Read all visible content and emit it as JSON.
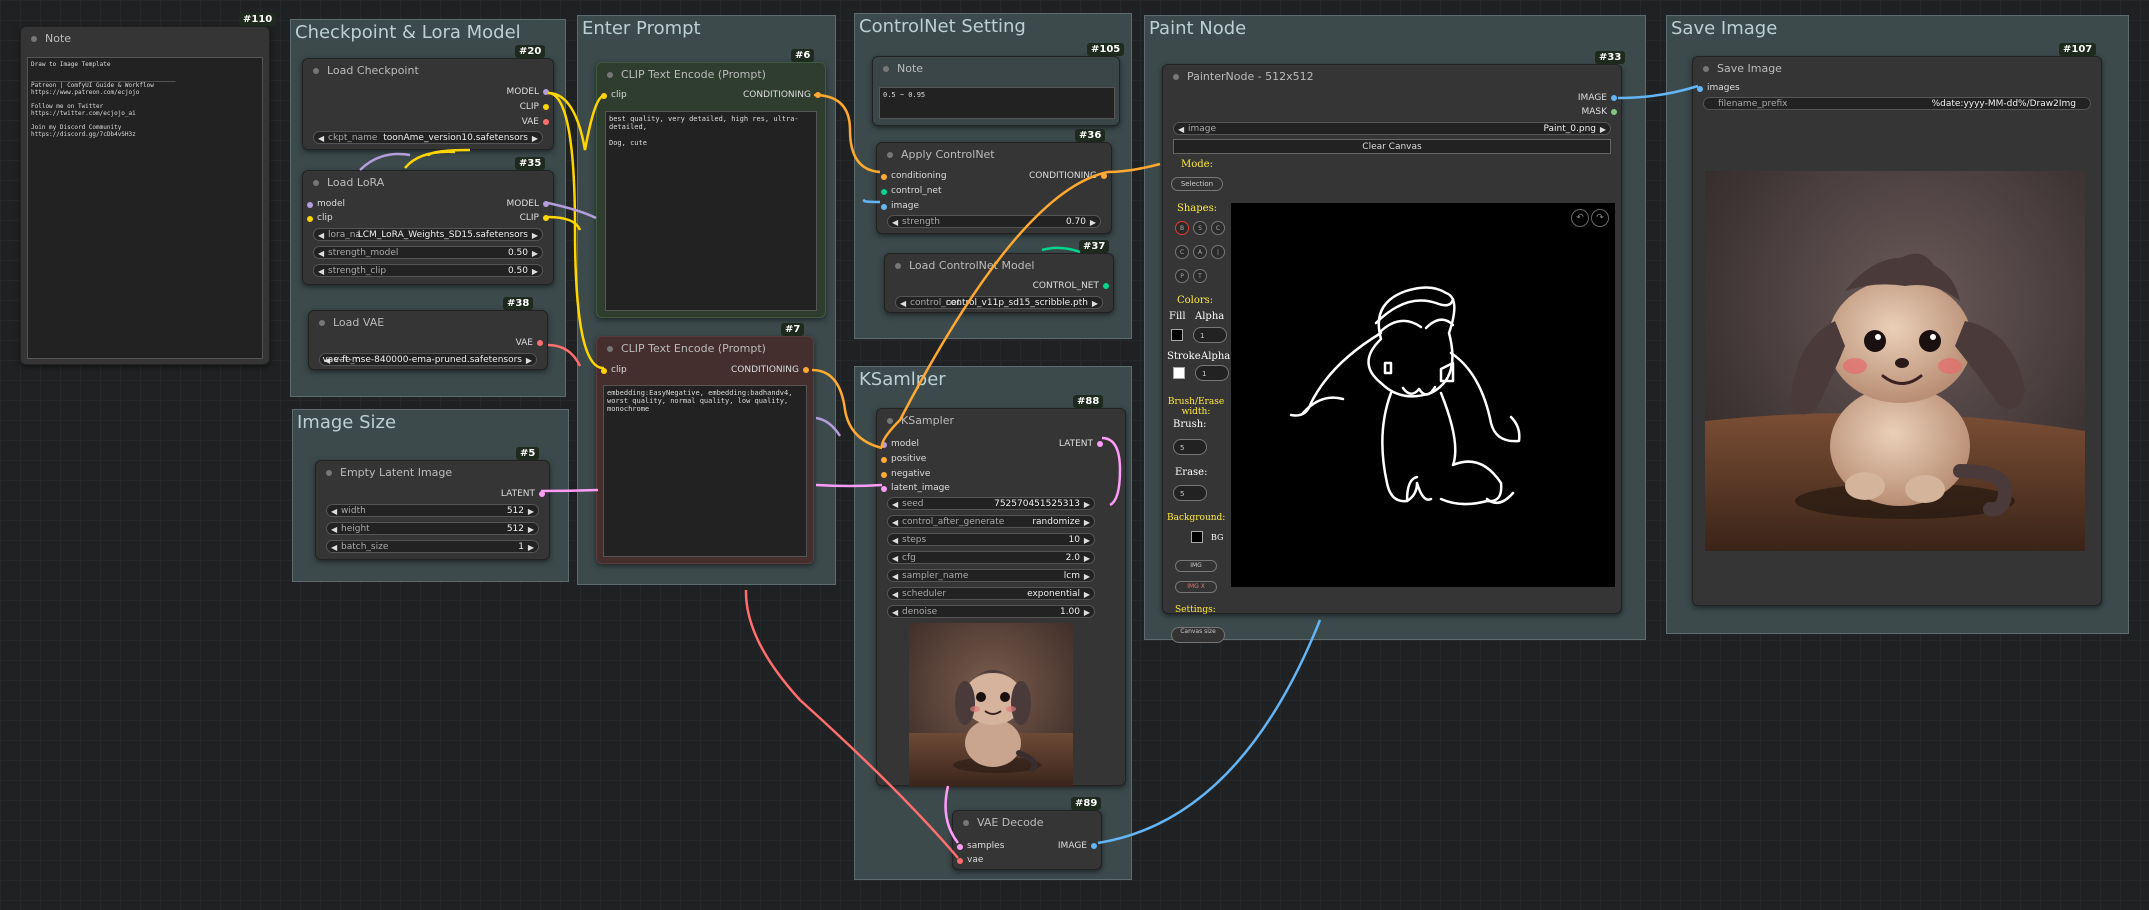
{
  "groups": {
    "checkpoint": "Checkpoint & Lora Model",
    "image_size": "Image Size",
    "prompt": "Enter Prompt",
    "controlnet": "ControlNet Setting",
    "ksampler": "KSamlper",
    "paint": "Paint Node",
    "save": "Save Image"
  },
  "note110": {
    "title": "Note",
    "badge": "#110",
    "text": "Draw to Image Template\n\n________________________________________\nPatreon | ComfyUI Guide & Workflow\nhttps://www.patreon.com/ecjojo\n\nFollow me on Twitter\nhttps://twitter.com/ecjojo_ai\n\nJoin my Discord Community\nhttps://discord.gg/7cDb4vSH3z"
  },
  "load_checkpoint": {
    "title": "Load Checkpoint",
    "badge": "#20",
    "out_model": "MODEL",
    "out_clip": "CLIP",
    "out_vae": "VAE",
    "ckpt_label": "ckpt_name",
    "ckpt_value": "toonAme_version10.safetensors"
  },
  "load_lora": {
    "title": "Load LoRA",
    "badge": "#35",
    "in_model": "model",
    "in_clip": "clip",
    "out_model": "MODEL",
    "out_clip": "CLIP",
    "lora_label": "lora_na",
    "lora_value": "LCM_LoRA_Weights_SD15.safetensors",
    "strength_model_label": "strength_model",
    "strength_model_value": "0.50",
    "strength_clip_label": "strength_clip",
    "strength_clip_value": "0.50"
  },
  "load_vae": {
    "title": "Load VAE",
    "badge": "#38",
    "out_vae": "VAE",
    "vae_label": "vae_n",
    "vae_value": "vae-ft-mse-840000-ema-pruned.safetensors"
  },
  "empty_latent": {
    "title": "Empty Latent Image",
    "badge": "#5",
    "out_latent": "LATENT",
    "width_label": "width",
    "width_value": "512",
    "height_label": "height",
    "height_value": "512",
    "batch_label": "batch_size",
    "batch_value": "1"
  },
  "clip_pos": {
    "title": "CLIP Text Encode (Prompt)",
    "badge": "#6",
    "in_clip": "clip",
    "out_cond": "CONDITIONING",
    "text": "best quality, very detailed, high res, ultra-detailed,\n\nDog, cute"
  },
  "clip_neg": {
    "title": "CLIP Text Encode (Prompt)",
    "badge": "#7",
    "in_clip": "clip",
    "out_cond": "CONDITIONING",
    "text": "embedding:EasyNegative, embedding:badhandv4, worst quality, normal quality, low quality, monochrome"
  },
  "note105": {
    "title": "Note",
    "badge": "#105",
    "text": "0.5 ~ 0.95"
  },
  "apply_cn": {
    "title": "Apply ControlNet",
    "badge": "#36",
    "in_cond": "conditioning",
    "in_cn": "control_net",
    "in_image": "image",
    "out_cond": "CONDITIONING",
    "strength_label": "strength",
    "strength_value": "0.70"
  },
  "load_cn": {
    "title": "Load ControlNet Model",
    "badge": "#37",
    "out_cn": "CONTROL_NET",
    "cn_label": "control_net",
    "cn_value": "control_v11p_sd15_scribble.pth"
  },
  "ksampler": {
    "title": "KSampler",
    "badge": "#88",
    "in_model": "model",
    "in_pos": "positive",
    "in_neg": "negative",
    "in_latent": "latent_image",
    "out_latent": "LATENT",
    "seed_label": "seed",
    "seed_value": "752570451525313",
    "cag_label": "control_after_generate",
    "cag_value": "randomize",
    "steps_label": "steps",
    "steps_value": "10",
    "cfg_label": "cfg",
    "cfg_value": "2.0",
    "sampler_label": "sampler_name",
    "sampler_value": "lcm",
    "scheduler_label": "scheduler",
    "scheduler_value": "exponential",
    "denoise_label": "denoise",
    "denoise_value": "1.00"
  },
  "vae_decode": {
    "title": "VAE Decode",
    "badge": "#89",
    "in_samples": "samples",
    "in_vae": "vae",
    "out_image": "IMAGE"
  },
  "painter": {
    "title": "PainterNode - 512x512",
    "badge": "#33",
    "out_image": "IMAGE",
    "out_mask": "MASK",
    "image_label": "image",
    "image_value": "Paint_0.png",
    "clear": "Clear Canvas",
    "mode": "Mode:",
    "selection": "Selection",
    "shapes": "Shapes:",
    "shape_btns": [
      "B",
      "S",
      "C",
      "C",
      "A",
      "|",
      "P",
      "T"
    ],
    "colors": "Colors:",
    "fill": "Fill",
    "alpha": "Alpha",
    "fill_alpha": "1",
    "stroke": "Stroke",
    "stroke_alpha": "1",
    "brush_erase": "Brush/Erase width:",
    "brush": "Brush:",
    "brush_value": "5",
    "erase": "Erase:",
    "erase_value": "5",
    "background": "Background:",
    "bg": "BG",
    "img_btn": "IMG",
    "img_x_btn": "IMG X",
    "settings": "Settings:",
    "canvas_size": "Canvas size"
  },
  "save_image": {
    "title": "Save Image",
    "badge": "#107",
    "in_images": "images",
    "prefix_label": "filename_prefix",
    "prefix_value": "%date:yyyy-MM-dd%/Draw2Img"
  },
  "colors": {
    "model": "#b39ddb",
    "clip": "#ffd500",
    "vae": "#ff6e6e",
    "latent": "#ff9cf9",
    "conditioning": "#ffa931",
    "image": "#64b5f6",
    "control_net": "#00d78d",
    "group": "#3c4a4c",
    "node": "#353535",
    "clip_pos_bg": "#2e3d2e",
    "clip_neg_bg": "#442e2e"
  }
}
